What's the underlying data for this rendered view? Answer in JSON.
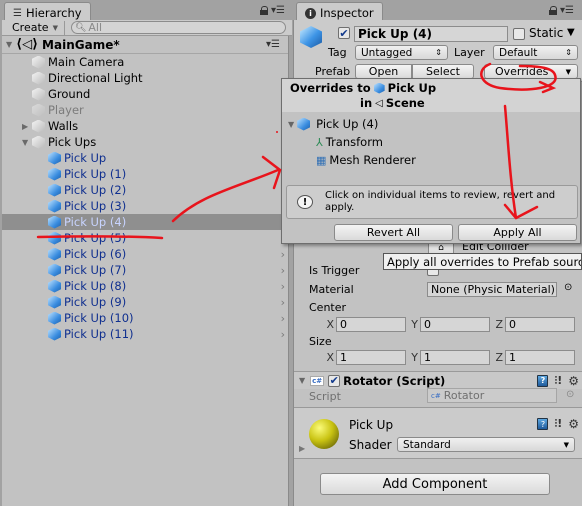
{
  "hierarchy": {
    "tab_label": "Hierarchy",
    "create_label": "Create",
    "search_placeholder": "All",
    "scene_name": "MainGame*",
    "items": [
      {
        "label": "Main Camera",
        "style": "normal"
      },
      {
        "label": "Directional Light",
        "style": "normal"
      },
      {
        "label": "Ground",
        "style": "normal"
      },
      {
        "label": "Player",
        "style": "disabled"
      },
      {
        "label": "Walls",
        "style": "normal",
        "expander": "collapsed"
      },
      {
        "label": "Pick Ups",
        "style": "normal",
        "expander": "expanded"
      },
      {
        "label": "Pick Up",
        "style": "prefab"
      },
      {
        "label": "Pick Up (1)",
        "style": "prefab"
      },
      {
        "label": "Pick Up (2)",
        "style": "prefab"
      },
      {
        "label": "Pick Up (3)",
        "style": "prefab"
      },
      {
        "label": "Pick Up (4)",
        "style": "prefab",
        "selected": true
      },
      {
        "label": "Pick Up (5)",
        "style": "prefab"
      },
      {
        "label": "Pick Up (6)",
        "style": "prefab"
      },
      {
        "label": "Pick Up (7)",
        "style": "prefab"
      },
      {
        "label": "Pick Up (8)",
        "style": "prefab"
      },
      {
        "label": "Pick Up (9)",
        "style": "prefab"
      },
      {
        "label": "Pick Up (10)",
        "style": "prefab"
      },
      {
        "label": "Pick Up (11)",
        "style": "prefab"
      }
    ]
  },
  "inspector": {
    "tab_label": "Inspector",
    "object_name": "Pick Up (4)",
    "active_checked": true,
    "static_label": "Static",
    "static_checked": false,
    "tag_label": "Tag",
    "tag_value": "Untagged",
    "layer_label": "Layer",
    "layer_value": "Default",
    "prefab_label": "Prefab",
    "open_label": "Open",
    "select_label": "Select",
    "overrides_label": "Overrides",
    "collider": {
      "edit_collider_label": "Edit Collider",
      "is_trigger_label": "Is Trigger",
      "is_trigger_checked": false,
      "material_label": "Material",
      "material_value": "None (Physic Material)",
      "center_label": "Center",
      "center": {
        "x": "0",
        "y": "0",
        "z": "0"
      },
      "size_label": "Size",
      "size": {
        "x": "1",
        "y": "1",
        "z": "1"
      },
      "axis_x": "X",
      "axis_y": "Y",
      "axis_z": "Z"
    },
    "rotator": {
      "title": "Rotator (Script)",
      "enabled": true,
      "script_label": "Script",
      "script_value": "Rotator",
      "cs_badge": "c#"
    },
    "material": {
      "name": "Pick Up",
      "shader_label": "Shader",
      "shader_value": "Standard"
    },
    "add_component_label": "Add Component"
  },
  "overrides_popup": {
    "title_prefix": "Overrides to",
    "title_prefab": "Pick Up",
    "title_in": "in",
    "title_scene": "Scene",
    "root_item": "Pick Up (4)",
    "components": [
      "Transform",
      "Mesh Renderer"
    ],
    "info_text": "Click on individual items to review, revert and apply.",
    "revert_all_label": "Revert All",
    "apply_all_label": "Apply All"
  },
  "tooltip": "Apply all overrides to Prefab source",
  "annotation_color": "#e8141c"
}
